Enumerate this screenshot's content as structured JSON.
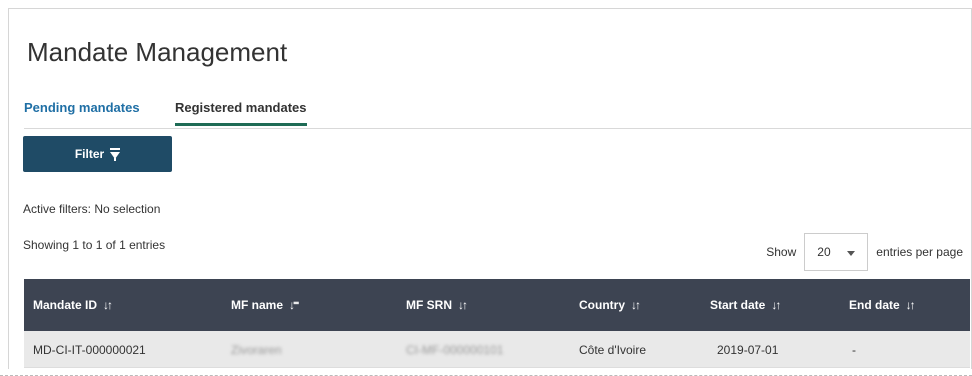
{
  "header": {
    "title": "Mandate Management"
  },
  "tabs": [
    {
      "label": "Pending mandates"
    },
    {
      "label": "Registered mandates"
    }
  ],
  "filter": {
    "label": "Filter",
    "icon": "filter-icon"
  },
  "active_filters": {
    "label": "Active filters:",
    "value": "No selection"
  },
  "showing": "Showing 1 to 1 of 1 entries",
  "page_size": {
    "prefix": "Show",
    "value": "20",
    "suffix": "entries per page"
  },
  "table": {
    "columns": [
      "Mandate ID",
      "MF name",
      "MF SRN",
      "Country",
      "Start date",
      "End date"
    ],
    "rows": [
      {
        "mandate_id": "MD-CI-IT-000000021",
        "mf_name": "Zivoraren",
        "mf_srn": "CI-MF-000000101",
        "country": "Côte d'Ivoire",
        "start_date": "2019-07-01",
        "end_date": "-"
      }
    ]
  },
  "colors": {
    "header_bg": "#3d4452",
    "button_bg": "#1f4b66",
    "active_tab_underline": "#1e6b55",
    "link": "#1f6fa5"
  }
}
